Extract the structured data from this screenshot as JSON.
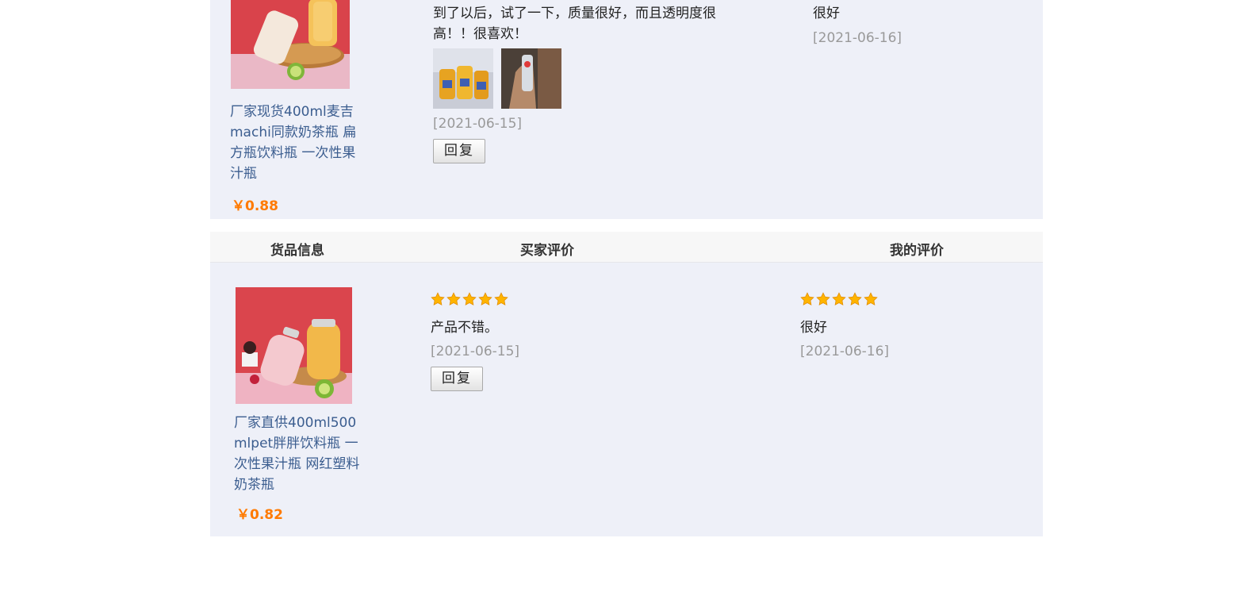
{
  "colors": {
    "panel_bg": "#eef0f8",
    "link": "#3b5d8f",
    "price": "#ff7a00",
    "date": "#999999",
    "star": "#ffb400"
  },
  "review1": {
    "product_title": "厂家现货400ml麦吉machi同款奶茶瓶 扁方瓶饮料瓶 一次性果汁瓶",
    "price": "￥0.88",
    "buyer_comment": "到了以后，试了一下，质量很好，而且透明度很高！！很喜欢！",
    "buyer_date": "[2021-06-15]",
    "reply_label": "回复",
    "my_comment": "很好",
    "my_date": "[2021-06-16]",
    "photos": [
      "review-photo-bottles",
      "review-photo-hand"
    ]
  },
  "review2": {
    "headers": {
      "goods": "货品信息",
      "buyer": "买家评价",
      "mine": "我的评价"
    },
    "product_title": "厂家直供400ml500mlpet胖胖饮料瓶 一次性果汁瓶 网红塑料奶茶瓶",
    "price": "￥0.82",
    "buyer_rating": 5,
    "buyer_comment": "产品不错。",
    "buyer_date": "[2021-06-15]",
    "reply_label": "回复",
    "my_rating": 5,
    "my_comment": "很好",
    "my_date": "[2021-06-16]"
  }
}
